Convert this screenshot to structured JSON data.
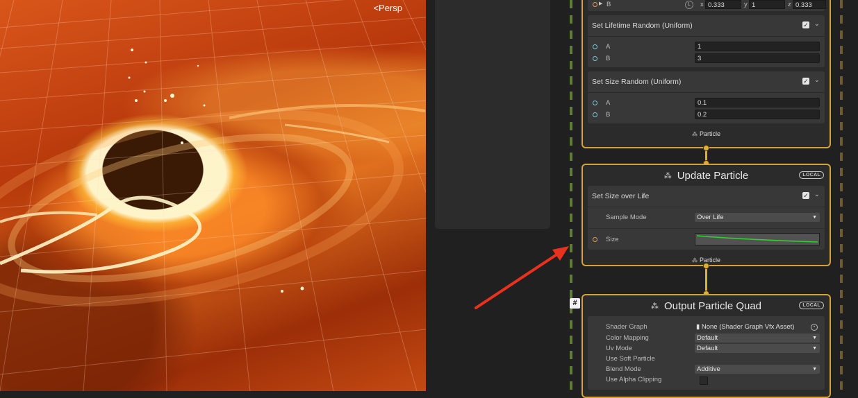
{
  "scene": {
    "view_label": "Persp"
  },
  "init_context": {
    "top_row": {
      "label": "B",
      "lock": "L",
      "x_label": "x",
      "x": "0.333",
      "y_label": "y",
      "y": "1",
      "z_label": "z",
      "z": "0.333"
    },
    "blocks": [
      {
        "title": "Set Lifetime Random (Uniform)",
        "rows": [
          {
            "label": "A",
            "value": "1"
          },
          {
            "label": "B",
            "value": "3"
          }
        ]
      },
      {
        "title": "Set Size Random (Uniform)",
        "rows": [
          {
            "label": "A",
            "value": "0.1"
          },
          {
            "label": "B",
            "value": "0.2"
          }
        ]
      }
    ],
    "footer": "Particle"
  },
  "update_context": {
    "title": "Update Particle",
    "badge": "LOCAL",
    "block": {
      "title": "Set Size over Life",
      "sample_mode_label": "Sample Mode",
      "sample_mode_value": "Over Life",
      "size_label": "Size"
    },
    "footer": "Particle"
  },
  "output_context": {
    "badge_hash": "#",
    "title": "Output Particle Quad",
    "badge": "LOCAL",
    "settings": [
      {
        "label": "Shader Graph",
        "value": "None (Shader Graph Vfx Asset)",
        "kind": "object"
      },
      {
        "label": "Color Mapping",
        "value": "Default",
        "kind": "dropdown"
      },
      {
        "label": "Uv Mode",
        "value": "Default",
        "kind": "dropdown"
      },
      {
        "label": "Use Soft Particle",
        "value": "",
        "kind": "none"
      },
      {
        "label": "Blend Mode",
        "value": "Additive",
        "kind": "dropdown"
      },
      {
        "label": "Use Alpha Clipping",
        "value": "",
        "kind": "checkbox"
      }
    ]
  },
  "annotation": {
    "type": "red-arrow",
    "color": "#e8321e"
  },
  "colors": {
    "context_border": "#d4a236",
    "curve": "#2fd02f",
    "flow_dash": "#5d7e34"
  }
}
